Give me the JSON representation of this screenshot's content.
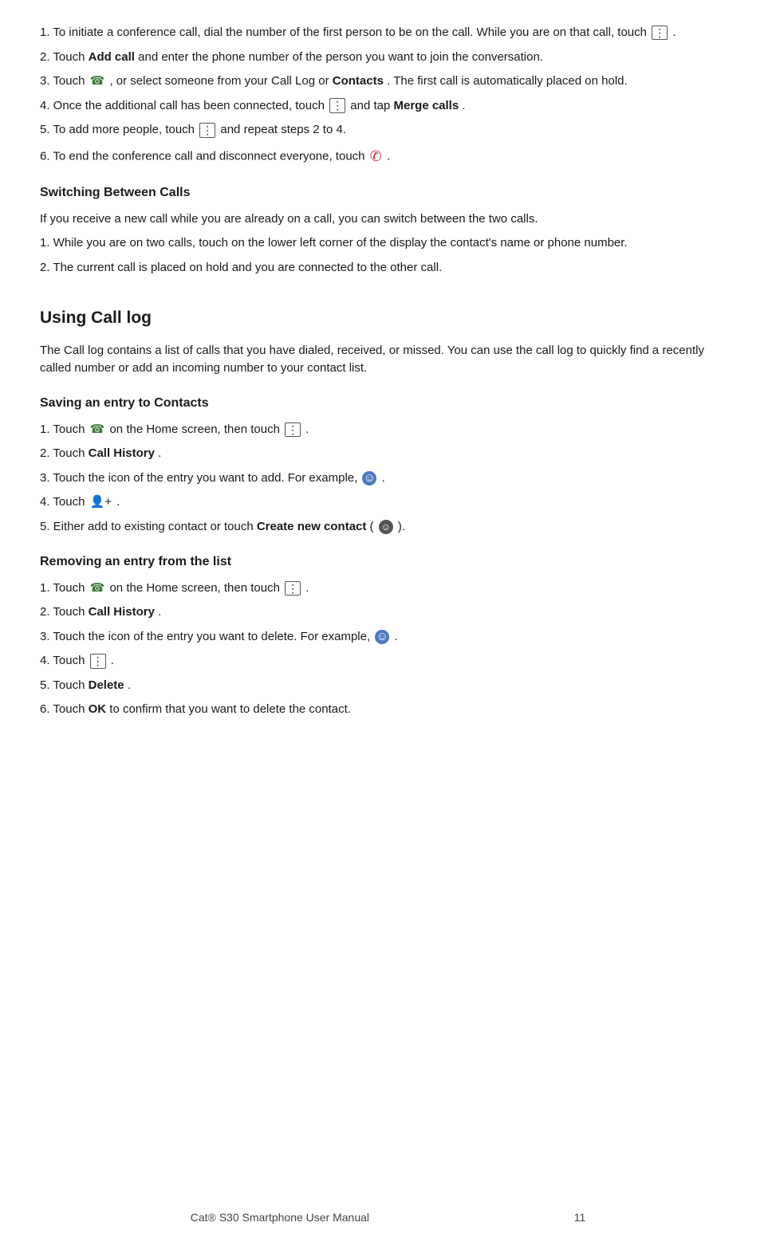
{
  "content": {
    "step1": {
      "text_before": "1. To initiate a conference call, dial the number of the first person to be on the call. While you are on that call, touch",
      "icon": "⋮",
      "text_after": "."
    },
    "step2": {
      "text_before": "2. Touch",
      "bold": "Add call",
      "text_after": "and enter the phone number of the person you want to join the conversation."
    },
    "step3": {
      "text_before": "3. Touch",
      "icon": "phone",
      "text_after": ", or select someone from your Call Log or",
      "bold": "Contacts",
      "text_after2": ". The first call is automatically placed on hold."
    },
    "step4": {
      "text_before": "4. Once the additional call has been connected, touch",
      "icon": "⋮",
      "text_middle": "and tap",
      "bold": "Merge calls",
      "text_after": "."
    },
    "step5": {
      "text_before": "5. To add more people, touch",
      "icon": "⋮",
      "text_after": "and repeat steps 2 to 4."
    },
    "step6": {
      "text_before": "6. To end the conference call and disconnect everyone, touch",
      "icon": "endcall",
      "text_after": "."
    },
    "switching_heading": "Switching Between Calls",
    "switching_para": "If you receive a new call while you are already on a call, you can switch between the two calls.",
    "switching_step1": "1. While you are on two calls, touch on the lower left corner of the display the contact's name or phone number.",
    "switching_step2": "2. The current call is placed on hold and you are connected to the other call.",
    "using_calllog_heading": "Using Call log",
    "using_calllog_para": "The Call log contains a list of calls that you have dialed, received, or missed. You can use the call log to quickly find a recently called number or add an incoming number to your contact list.",
    "saving_heading": "Saving an entry to Contacts",
    "saving_step1_before": "1. Touch",
    "saving_step1_mid": "on the Home screen, then touch",
    "saving_step1_icon": "⋮",
    "saving_step1_after": ".",
    "saving_step2_before": "2. Touch",
    "saving_step2_bold": "Call History",
    "saving_step2_after": ".",
    "saving_step3_before": "3. Touch the icon of the entry you want to add. For example,",
    "saving_step3_after": ".",
    "saving_step4_before": "4. Touch",
    "saving_step4_after": ".",
    "saving_step5_before": "5. Either add to existing contact or touch",
    "saving_step5_bold": "Create new contact",
    "saving_step5_after": "(   ).",
    "removing_heading": "Removing an entry from the list",
    "removing_step1_before": "1. Touch",
    "removing_step1_mid": "on the Home screen, then touch",
    "removing_step2_before": "2. Touch",
    "removing_step2_bold": "Call History",
    "removing_step2_after": ".",
    "removing_step3_before": "3. Touch the icon of the entry you want to delete. For example,",
    "removing_step3_after": ".",
    "removing_step4_before": "4. Touch",
    "removing_step4_after": ".",
    "removing_step5_before": "5. Touch",
    "removing_step5_bold": "Delete",
    "removing_step5_after": ".",
    "removing_step6_before": "6. Touch",
    "removing_step6_bold": "OK",
    "removing_step6_after": "to confirm that you want to delete the contact.",
    "footer": "Cat® S30 Smartphone User Manual",
    "page_number": "11"
  }
}
